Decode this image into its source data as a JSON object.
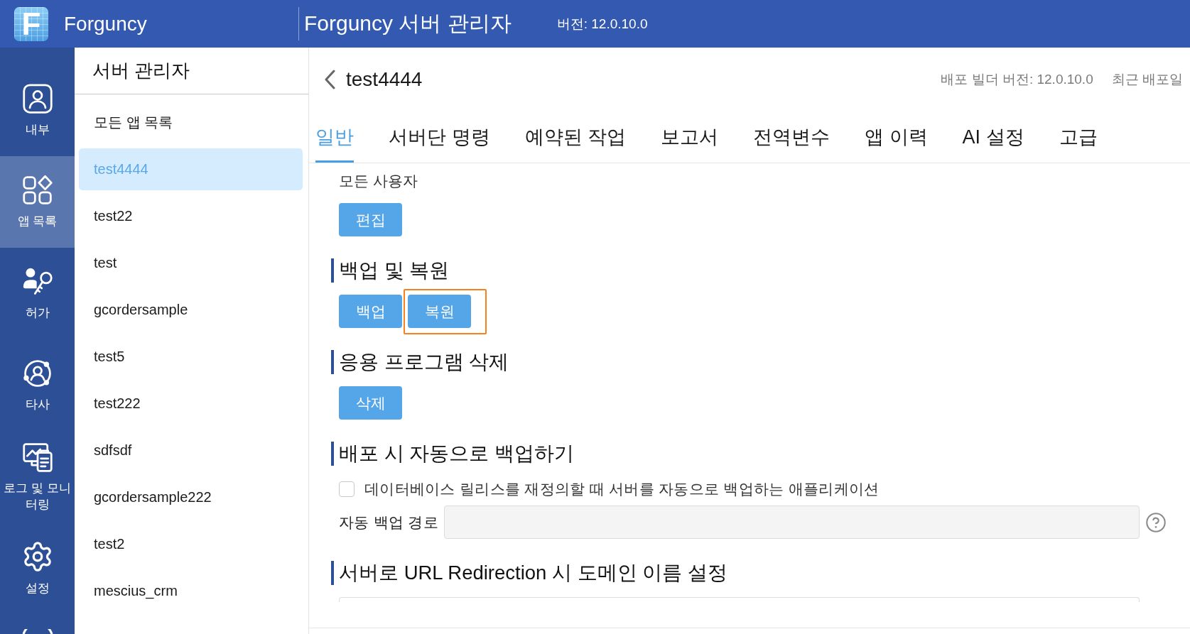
{
  "top_bar": {
    "logo_letter": "F",
    "brand": "Forguncy",
    "title": "Forguncy 서버 관리자",
    "version": "버전: 12.0.10.0"
  },
  "nav": [
    {
      "label": "내부",
      "selected": false
    },
    {
      "label": "앱 목록",
      "selected": true
    },
    {
      "label": "허가",
      "selected": false
    },
    {
      "label": "타사",
      "selected": false
    },
    {
      "label": "로그 및 모니터링",
      "selected": false
    },
    {
      "label": "설정",
      "selected": false
    }
  ],
  "app_list": {
    "title": "서버 관리자",
    "all_apps": "모든 앱 목록",
    "apps": [
      {
        "name": "test4444",
        "selected": true
      },
      {
        "name": "test22",
        "selected": false
      },
      {
        "name": "test",
        "selected": false
      },
      {
        "name": "gcordersample",
        "selected": false
      },
      {
        "name": "test5",
        "selected": false
      },
      {
        "name": "test222",
        "selected": false
      },
      {
        "name": "sdfsdf",
        "selected": false
      },
      {
        "name": "gcordersample222",
        "selected": false
      },
      {
        "name": "test2",
        "selected": false
      },
      {
        "name": "mescius_crm",
        "selected": false
      }
    ]
  },
  "app_header": {
    "name": "test4444",
    "builder_version": "배포 빌더 버전: 12.0.10.0",
    "last_deployed": "최근 배포일"
  },
  "tabs": [
    {
      "label": "일반",
      "selected": true
    },
    {
      "label": "서버단 명령",
      "selected": false
    },
    {
      "label": "예약된 작업",
      "selected": false
    },
    {
      "label": "보고서",
      "selected": false
    },
    {
      "label": "전역변수",
      "selected": false
    },
    {
      "label": "앱 이력",
      "selected": false
    },
    {
      "label": "AI 설정",
      "selected": false
    },
    {
      "label": "고급",
      "selected": false
    }
  ],
  "general": {
    "access_label": "모든 사용자",
    "access_buttons": [
      {
        "label": "편집",
        "highlighted": false
      }
    ],
    "sections": [
      {
        "kind": "buttons",
        "title": "백업 및 복원",
        "buttons": [
          {
            "label": "백업",
            "highlighted": false
          },
          {
            "label": "복원",
            "highlighted": true
          }
        ]
      },
      {
        "kind": "buttons",
        "title": "응용 프로그램 삭제",
        "buttons": [
          {
            "label": "삭제",
            "highlighted": false
          }
        ]
      },
      {
        "kind": "auto_backup",
        "title": "배포 시 자동으로 백업하기",
        "checkbox": {
          "label": "데이터베이스 릴리스를 재정의할 때 서버를 자동으로 백업하는 애플리케이션",
          "checked": false
        },
        "path": {
          "label": "자동 백업 경로"
        }
      },
      {
        "kind": "domain",
        "title": "서버로 URL Redirection 시 도메인 이름 설정"
      }
    ]
  }
}
